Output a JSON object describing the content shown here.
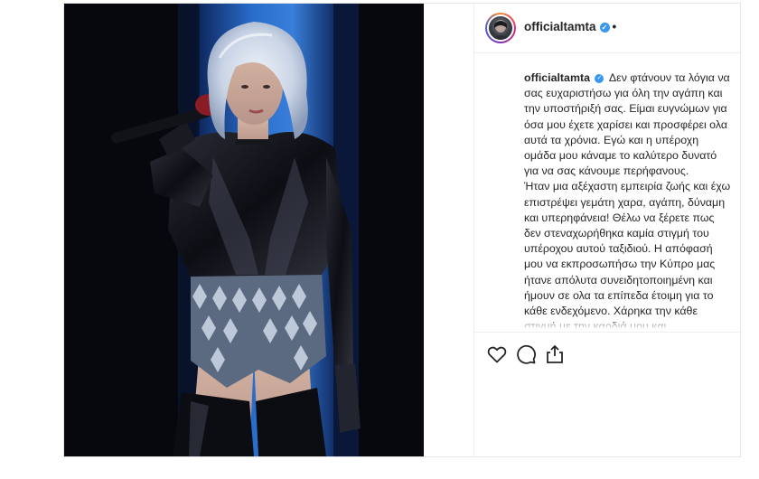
{
  "post": {
    "username": "officialtamta",
    "dot": "•",
    "caption": {
      "username": "officialtamta",
      "text": "Δεν φτάνουν τα λόγια να σας ευχαριστήσω για όλη την αγάπη και την υποστήριξή σας. Είμαι ευγνώμων για όσα μου έχετε χαρίσει και προσφέρει ολα αυτά τα χρόνια. Εγώ και η υπέροχη ομάδα μου κάναμε το καλύτερο δυνατό για να σας κάνουμε περήφανους.\nΉταν μια αξέχαστη εμπειρία ζωής και έχω επιστρέψει γεμάτη χαρα, αγάπη, δύναμη και υπερηφάνεια! Θέλω να ξέρετε πως δεν στεναχωρήθηκα καμία στιγμή του υπέροχου αυτού ταξιδιού. Η απόφασή μου να εκπροσωπήσω την Κύπρο μας ήτανε απόλυτα συνειδητοποιημένη και ήμουν σε ολα τα επίπεδα έτοιμη για το κάθε ενδεχόμενο. Χάρηκα την κάθε στιγμή με την καρδιά μου και"
    },
    "icons": {
      "verified": "verified-badge-icon",
      "like": "heart-icon",
      "comment": "comment-icon",
      "share": "share-icon"
    },
    "colors": {
      "verified": "#3897f0",
      "stage_blue": "#2a6fd6"
    }
  }
}
